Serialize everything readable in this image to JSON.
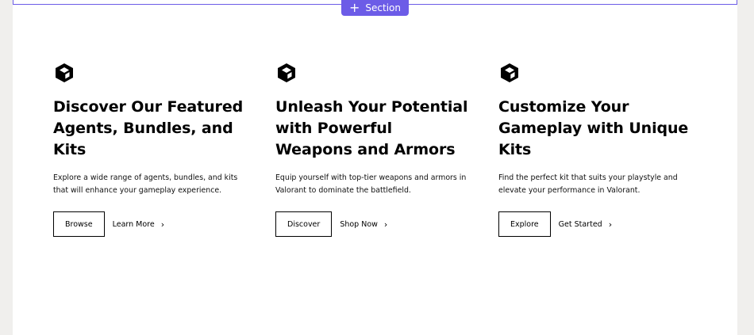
{
  "toolbar": {
    "add_section_label": "Section"
  },
  "colors": {
    "accent": "#6c5ce7",
    "page_bg": "#f0efed",
    "canvas_bg": "#ffffff",
    "text": "#000000"
  },
  "features": [
    {
      "icon": "cube-icon",
      "title": "Discover Our Featured Agents, Bundles, and Kits",
      "description": "Explore a wide range of agents, bundles, and kits that will enhance your gameplay experience.",
      "primary_label": "Browse",
      "link_label": "Learn More"
    },
    {
      "icon": "cube-icon",
      "title": "Unleash Your Potential with Powerful Weapons and Armors",
      "description": "Equip yourself with top-tier weapons and armors in Valorant to dominate the battlefield.",
      "primary_label": "Discover",
      "link_label": "Shop Now"
    },
    {
      "icon": "cube-icon",
      "title": "Customize Your Gameplay with Unique Kits",
      "description": "Find the perfect kit that suits your playstyle and elevate your performance in Valorant.",
      "primary_label": "Explore",
      "link_label": "Get Started"
    }
  ]
}
